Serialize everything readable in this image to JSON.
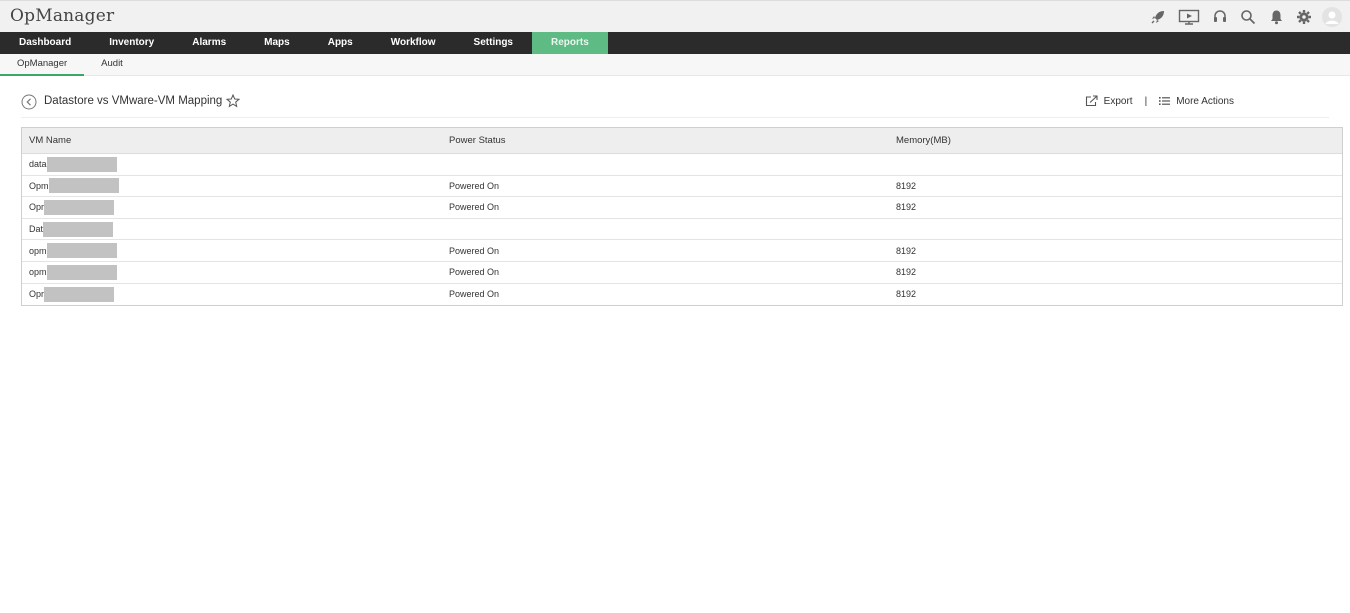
{
  "app": {
    "title": "OpManager"
  },
  "top_icons": [
    "rocket-icon",
    "monitor-play-icon",
    "headset-icon",
    "search-icon",
    "bell-icon",
    "gear-icon",
    "user-avatar-icon"
  ],
  "nav": {
    "items": [
      "Dashboard",
      "Inventory",
      "Alarms",
      "Maps",
      "Apps",
      "Workflow",
      "Settings",
      "Reports"
    ],
    "active": "Reports",
    "active_color": "#5dbb83"
  },
  "subnav": {
    "items": [
      "OpManager",
      "Audit"
    ],
    "active": "OpManager"
  },
  "page": {
    "title": "Datastore vs VMware-VM Mapping",
    "export_label": "Export",
    "separator": "|",
    "more_actions_label": "More Actions"
  },
  "table": {
    "columns": [
      "VM Name",
      "Power Status",
      "Memory(MB)"
    ],
    "rows": [
      {
        "vm_name": "data",
        "power_status": "",
        "memory": ""
      },
      {
        "vm_name": "Opm",
        "power_status": "Powered On",
        "memory": "8192"
      },
      {
        "vm_name": "Opr",
        "power_status": "Powered On",
        "memory": "8192"
      },
      {
        "vm_name": "Dat",
        "power_status": "",
        "memory": ""
      },
      {
        "vm_name": "opm",
        "power_status": "Powered On",
        "memory": "8192"
      },
      {
        "vm_name": "opm",
        "power_status": "Powered On",
        "memory": "8192"
      },
      {
        "vm_name": "Opr",
        "power_status": "Powered On",
        "memory": "8192"
      }
    ]
  }
}
